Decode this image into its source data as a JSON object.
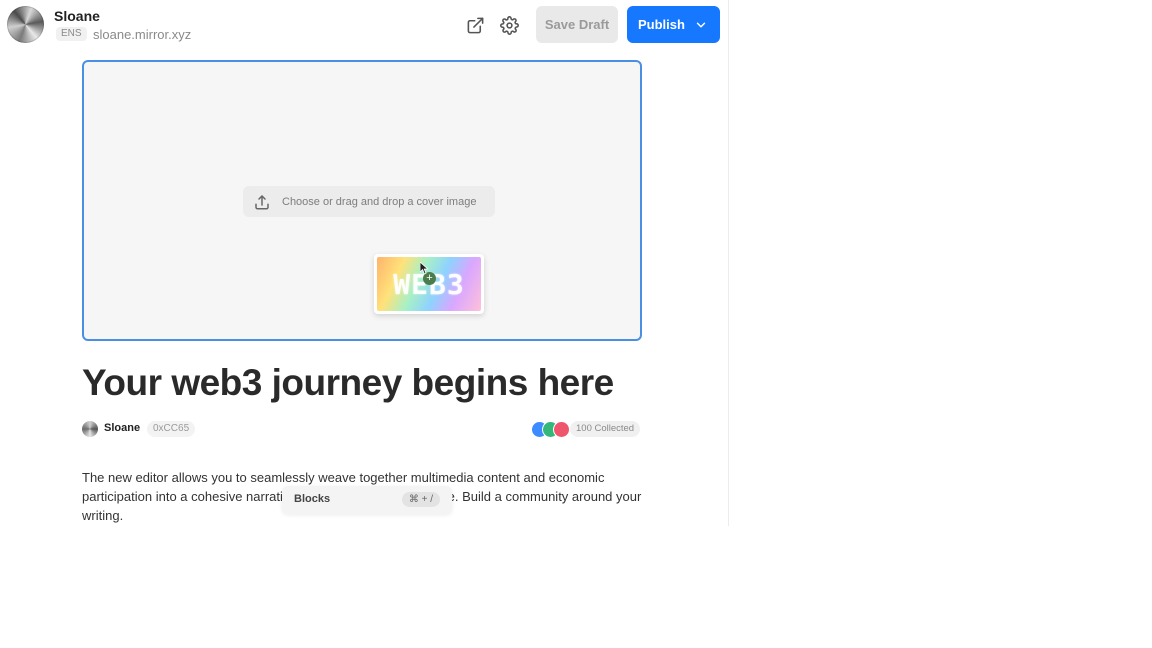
{
  "header": {
    "user_name": "Sloane",
    "ens_badge": "ENS",
    "domain": "sloane.mirror.xyz",
    "open_external_icon": "external-link-icon",
    "settings_icon": "gear-icon",
    "save_draft_label": "Save Draft",
    "publish_label": "Publish",
    "publish_chevron_icon": "chevron-down-icon"
  },
  "cover": {
    "upload_label": "Choose or drag and drop a cover image",
    "upload_icon": "upload-icon",
    "dragged_image_text": "WEB3"
  },
  "post": {
    "title": "Your web3 journey begins here",
    "author_name": "Sloane",
    "author_address": "0xCC65",
    "collected_label": "100 Collected",
    "collector_colors": [
      "#3d8bff",
      "#34b87a",
      "#f0556e"
    ],
    "body": "The new editor allows you to seamlessly weave together multimedia content and economic participation into a cohesive narrative that readers can collectible. Build a community around your writing."
  },
  "blocks_menu": {
    "label": "Blocks",
    "shortcut": "⌘ + /"
  },
  "colors": {
    "accent": "#1677ff",
    "cover_border": "#4a90e2"
  }
}
